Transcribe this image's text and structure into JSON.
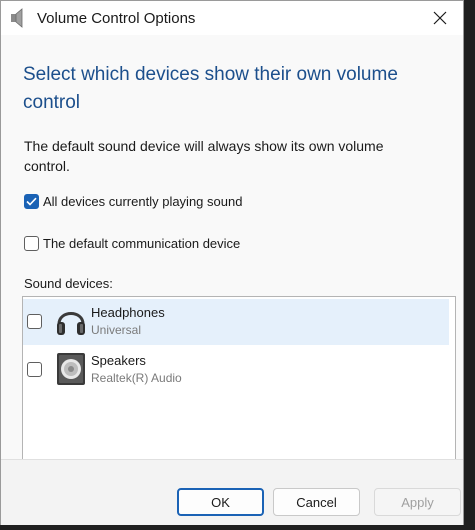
{
  "window": {
    "title": "Volume Control Options"
  },
  "heading": "Select which devices show their own volume control",
  "description": "The default sound device will always show its own volume control.",
  "options": [
    {
      "label": "All devices currently playing sound",
      "checked": true
    },
    {
      "label": "The default communication device",
      "checked": false
    }
  ],
  "sound_devices_label": "Sound devices:",
  "devices": [
    {
      "name": "Headphones",
      "subtitle": "Universal",
      "checked": false,
      "selected": true,
      "icon": "headphones-icon"
    },
    {
      "name": "Speakers",
      "subtitle": "Realtek(R) Audio",
      "checked": false,
      "selected": false,
      "icon": "speaker-icon"
    }
  ],
  "buttons": {
    "ok": "OK",
    "cancel": "Cancel",
    "apply": "Apply"
  },
  "colors": {
    "heading": "#1c4f8c",
    "accent": "#1a62b5",
    "selection": "#e5f0fb"
  }
}
